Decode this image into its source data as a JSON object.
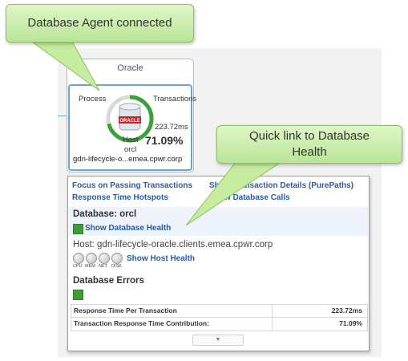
{
  "callouts": {
    "agent": "Database Agent connected",
    "health": "Quick link to Database Health"
  },
  "agent_card": {
    "title": "Oracle",
    "process_label": "Process",
    "transactions_label": "Transactions",
    "logo_text": "ORACLE",
    "time_value": "223.72ms",
    "percent_value": "71.09%",
    "host_label": "Host",
    "db_label": "orcl",
    "host_name": "gdn-lifecycle-o...emea.cpwr.corp",
    "gauge_fraction": 0.7109
  },
  "popup": {
    "links": {
      "focus_passing": "Focus on Passing Transactions",
      "show_transaction_details": "Show Transaction Details (PurePaths)",
      "response_time_hotspots": "Response Time Hotspots",
      "show_database_calls": "Show Database Calls"
    },
    "database": {
      "title": "Database: orcl",
      "health_link": "Show Database Health"
    },
    "host": {
      "title": "Host: gdn-lifecycle-oracle.clients.emea.cpwr.corp",
      "resources": [
        "CPU",
        "MEM",
        "NET",
        "DISK"
      ],
      "health_link": "Show Host Health"
    },
    "errors": {
      "title": "Database Errors"
    },
    "metrics": [
      {
        "label": "Response Time Per Transaction",
        "value": "223.72ms"
      },
      {
        "label": "Transaction Response Time Contribution:",
        "value": "71.09%"
      }
    ],
    "expander_icon": "▼"
  },
  "colors": {
    "callout_fill": "#c6ec9f",
    "link_blue": "#2a5aa8",
    "gauge_green": "#39a23a",
    "selection_blue": "#66a8dd",
    "status_green": "#3aa035"
  }
}
